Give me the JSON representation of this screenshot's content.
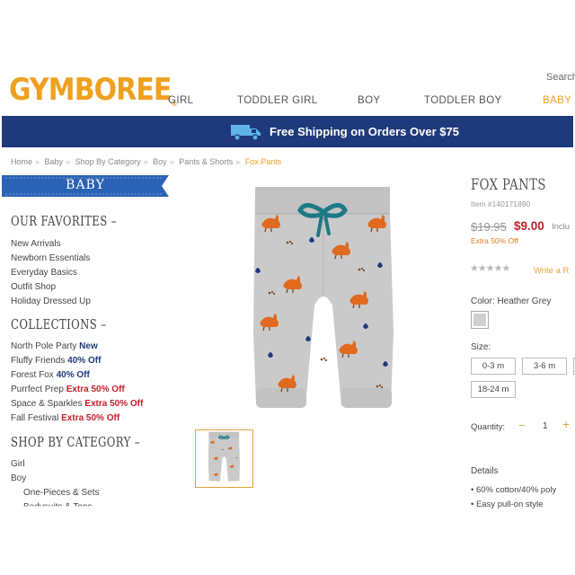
{
  "header": {
    "logo": "GYMBOREE",
    "search_label": "Search",
    "nav": [
      "GIRL",
      "TODDLER GIRL",
      "BOY",
      "TODDLER BOY",
      "BABY"
    ]
  },
  "promo": {
    "text": "Free Shipping on Orders Over $75"
  },
  "breadcrumb": [
    "Home",
    "Baby",
    "Shop By Category",
    "Boy",
    "Pants & Shorts",
    "Fox Pants"
  ],
  "sidebar": {
    "ribbon": "BABY",
    "favorites_title": "OUR FAVORITES",
    "favorites": [
      "New Arrivals",
      "Newborn Essentials",
      "Everyday Basics",
      "Outfit Shop",
      "Holiday Dressed Up"
    ],
    "collections_title": "COLLECTIONS",
    "collections": [
      {
        "name": "North Pole Party",
        "tag": "New",
        "tag_color": "blue"
      },
      {
        "name": "Fluffy Friends",
        "tag": "40% Off",
        "tag_color": "blue"
      },
      {
        "name": "Forest Fox",
        "tag": "40% Off",
        "tag_color": "blue"
      },
      {
        "name": "Purrfect Prep",
        "tag": "Extra 50% Off",
        "tag_color": "red"
      },
      {
        "name": "Space & Sparkles",
        "tag": "Extra 50% Off",
        "tag_color": "red"
      },
      {
        "name": "Fall Festival",
        "tag": "Extra 50% Off",
        "tag_color": "red"
      }
    ],
    "category_title": "SHOP BY CATEGORY",
    "categories": [
      "Girl",
      "Boy"
    ],
    "subcategories": [
      "One-Pieces & Sets",
      "Bodysuits & Tops"
    ]
  },
  "product": {
    "title": "FOX PANTS",
    "item_number": "Item #140171890",
    "price_original": "$19.95",
    "price_sale": "$9.00",
    "price_note": "Inclu",
    "promo_note": "Extra 50% Off",
    "rating_stars": "★★★★★",
    "review_link": "Write a R",
    "color_label": "Color: Heather Grey",
    "size_label": "Size:",
    "sizes": [
      "0-3 m",
      "3-6 m",
      "18-24 m"
    ],
    "quantity_label": "Quantity:",
    "quantity": "1",
    "qty_minus": "−",
    "qty_plus": "+",
    "details_label": "Details",
    "details": [
      "• 60% cotton/40% poly",
      "• Easy pull-on style"
    ]
  },
  "colors": {
    "brand_orange": "#f0a020",
    "navy": "#1f3a7a",
    "sale_red": "#c41e2a",
    "ribbon_blue": "#2a63b5",
    "pants_grey": "#c9c9c9",
    "drawstring_teal": "#1c7a85",
    "fox_orange": "#e06a1f"
  },
  "icons": [
    "truck-icon",
    "swatch-heather-grey"
  ]
}
